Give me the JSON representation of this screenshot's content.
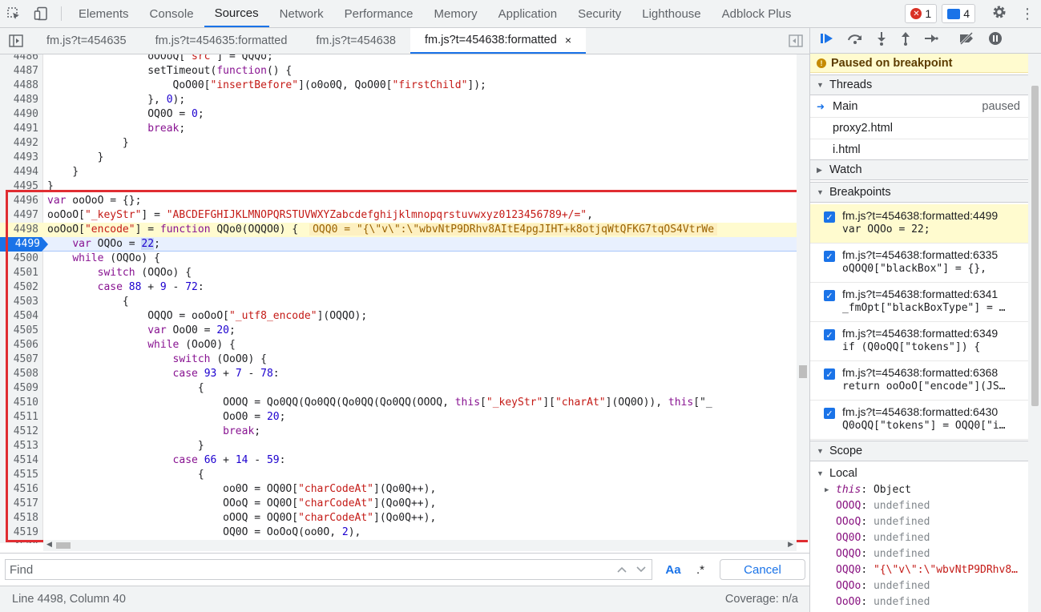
{
  "topbar": {
    "tabs": [
      "Elements",
      "Console",
      "Sources",
      "Network",
      "Performance",
      "Memory",
      "Application",
      "Security",
      "Lighthouse",
      "Adblock Plus"
    ],
    "active_tab": "Sources",
    "error_count": "1",
    "message_count": "4"
  },
  "files": {
    "tabs": [
      "fm.js?t=454635",
      "fm.js?t=454635:formatted",
      "fm.js?t=454638",
      "fm.js?t=454638:formatted"
    ],
    "active": "fm.js?t=454638:formatted",
    "close_glyph": "×"
  },
  "code": {
    "lines": [
      {
        "n": "4486",
        "html": "                oOOoQ[\"src\"] = QQQo;"
      },
      {
        "n": "4487",
        "html": "                setTimeout(function() {"
      },
      {
        "n": "4488",
        "html": "                    QoO00[\"insertBefore\"](o0o0Q, QoO00[\"firstChild\"]);"
      },
      {
        "n": "4489",
        "html": "                }, 0);"
      },
      {
        "n": "4490",
        "html": "                OQ0O = 0;"
      },
      {
        "n": "4491",
        "html": "                break;"
      },
      {
        "n": "4492",
        "html": "            }"
      },
      {
        "n": "4493",
        "html": "        }"
      },
      {
        "n": "4494",
        "html": "    }"
      },
      {
        "n": "4495",
        "html": "}"
      },
      {
        "n": "4496",
        "html": "var ooOoO = {};"
      },
      {
        "n": "4497",
        "html": "ooOoO[\"_keyStr\"] = \"ABCDEFGHIJKLMNOPQRSTUVWXYZabcdefghijklmnopqrstuvwxyz0123456789+/=\","
      },
      {
        "n": "4498",
        "html": "ooOoO[\"encode\"] = function QQo0(OQQO0) {"
      },
      {
        "n": "4499",
        "html": "    var OQOo = 22;"
      },
      {
        "n": "4500",
        "html": "    while (OQOo) {"
      },
      {
        "n": "4501",
        "html": "        switch (OQOo) {"
      },
      {
        "n": "4502",
        "html": "        case 88 + 9 - 72:"
      },
      {
        "n": "4503",
        "html": "            {"
      },
      {
        "n": "4504",
        "html": "                OQQO = ooOoO[\"_utf8_encode\"](OQQO);"
      },
      {
        "n": "4505",
        "html": "                var OoO0 = 20;"
      },
      {
        "n": "4506",
        "html": "                while (OoO0) {"
      },
      {
        "n": "4507",
        "html": "                    switch (OoO0) {"
      },
      {
        "n": "4508",
        "html": "                    case 93 + 7 - 78:"
      },
      {
        "n": "4509",
        "html": "                        {"
      },
      {
        "n": "4510",
        "html": "                            OOOQ = Qo0QQ(Qo0QQ(Qo0QQ(Qo0QQ(OOOQ, this[\"_keyStr\"][\"charAt\"](OQ0O)), this[\"_"
      },
      {
        "n": "4511",
        "html": "                            OoO0 = 20;"
      },
      {
        "n": "4512",
        "html": "                            break;"
      },
      {
        "n": "4513",
        "html": "                        }"
      },
      {
        "n": "4514",
        "html": "                    case 66 + 14 - 59:"
      },
      {
        "n": "4515",
        "html": "                        {"
      },
      {
        "n": "4516",
        "html": "                            oo0O = OQ0O[\"charCodeAt\"](Qo0Q++),"
      },
      {
        "n": "4517",
        "html": "                            OOoQ = OQ0O[\"charCodeAt\"](Qo0Q++),"
      },
      {
        "n": "4518",
        "html": "                            oOOQ = OQ0O[\"charCodeAt\"](Qo0Q++),"
      },
      {
        "n": "4519",
        "html": "                            OQ0O = OoOoQ(oo0O, 2),"
      },
      {
        "n": "4520",
        "html": ""
      }
    ],
    "paused_line": "4498",
    "exec_line": "4499",
    "inline_value": "OQQ0 = \"{\\\"v\\\":\\\"wbvNtP9DRhv8AItE4pgJIHT+k8otjqWtQFKG7tqOS4VtrWe"
  },
  "find": {
    "placeholder": "Find",
    "match_case": "Aa",
    "regex": ".*",
    "cancel": "Cancel"
  },
  "status": {
    "position": "Line 4498, Column 40",
    "coverage": "Coverage: n/a"
  },
  "sidebar": {
    "paused": "Paused on breakpoint",
    "threads_title": "Threads",
    "threads": [
      {
        "name": "Main",
        "status": "paused"
      },
      {
        "name": "proxy2.html",
        "status": ""
      },
      {
        "name": "i.html",
        "status": ""
      }
    ],
    "watch_title": "Watch",
    "breakpoints_title": "Breakpoints",
    "breakpoints": [
      {
        "loc": "fm.js?t=454638:formatted:4499",
        "src": "var OQOo = 22;"
      },
      {
        "loc": "fm.js?t=454638:formatted:6335",
        "src": "oQOQ0[\"blackBox\"] = {},"
      },
      {
        "loc": "fm.js?t=454638:formatted:6341",
        "src": "_fmOpt[\"blackBoxType\"] = …"
      },
      {
        "loc": "fm.js?t=454638:formatted:6349",
        "src": "if (Q0oQQ[\"tokens\"]) {"
      },
      {
        "loc": "fm.js?t=454638:formatted:6368",
        "src": "return ooOoO[\"encode\"](JS…"
      },
      {
        "loc": "fm.js?t=454638:formatted:6430",
        "src": "Q0oQQ[\"tokens\"] = OQQ0[\"i…"
      }
    ],
    "scope_title": "Scope",
    "local_title": "Local",
    "scope": [
      {
        "key": "this",
        "val": "Object",
        "kind": "this"
      },
      {
        "key": "OOOQ",
        "val": "undefined",
        "kind": "undef"
      },
      {
        "key": "OOoQ",
        "val": "undefined",
        "kind": "undef"
      },
      {
        "key": "OQ0O",
        "val": "undefined",
        "kind": "undef"
      },
      {
        "key": "OQQO",
        "val": "undefined",
        "kind": "undef"
      },
      {
        "key": "OQQ0",
        "val": "\"{\\\"v\\\":\\\"wbvNtP9DRhv8…",
        "kind": "str"
      },
      {
        "key": "OQOo",
        "val": "undefined",
        "kind": "undef"
      },
      {
        "key": "OoO0",
        "val": "undefined",
        "kind": "undef"
      }
    ]
  }
}
